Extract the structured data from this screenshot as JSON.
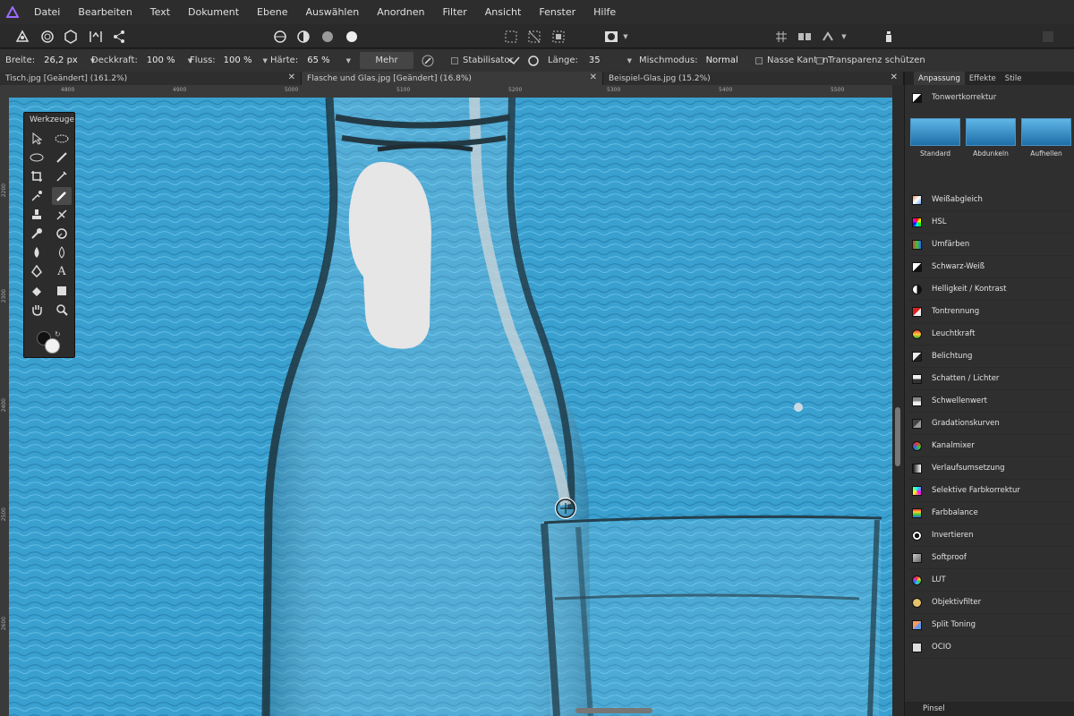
{
  "menu": [
    "Datei",
    "Bearbeiten",
    "Text",
    "Dokument",
    "Ebene",
    "Auswählen",
    "Anordnen",
    "Filter",
    "Ansicht",
    "Fenster",
    "Hilfe"
  ],
  "toolbar": {
    "width_label": "Breite:",
    "width_value": "26,2 px",
    "opacity_label": "Deckkraft:",
    "opacity_value": "100 %",
    "flow_label": "Fluss:",
    "flow_value": "100 %",
    "hardness_label": "Härte:",
    "hardness_value": "65 %",
    "more_label": "Mehr",
    "stabilizer_label": "Stabilisator",
    "length_label": "Länge:",
    "length_value": "35",
    "blendmode_label": "Mischmodus:",
    "blendmode_value": "Normal",
    "wet_edges_label": "Nasse Kanten",
    "protect_alpha_label": "Transparenz schützen"
  },
  "tabs": [
    {
      "label": "Tisch.jpg [Geändert] (161.2%)"
    },
    {
      "label": "Flasche und Glas.jpg [Geändert] (16.8%)"
    },
    {
      "label": "Beispiel-Glas.jpg (15.2%)"
    }
  ],
  "ruler": {
    "h": [
      "4800",
      "4900",
      "5000",
      "5100",
      "5200",
      "5300",
      "5400",
      "5500"
    ],
    "v": [
      "2200",
      "2300",
      "2400",
      "2500",
      "2600"
    ]
  },
  "werkzeuge": {
    "title": "Werkzeuge"
  },
  "panel": {
    "tabs": [
      "Anpassung",
      "Effekte",
      "Stile"
    ],
    "header": "Tonwertkorrektur",
    "presets": [
      "Standard",
      "Abdunkeln",
      "Aufhellen"
    ],
    "items": [
      "Weißabgleich",
      "HSL",
      "Umfärben",
      "Schwarz-Weiß",
      "Helligkeit / Kontrast",
      "Tontrennung",
      "Leuchtkraft",
      "Belichtung",
      "Schatten / Lichter",
      "Schwellenwert",
      "Gradationskurven",
      "Kanalmixer",
      "Verlaufsumsetzung",
      "Selektive Farbkorrektur",
      "Farbbalance",
      "Invertieren",
      "Softproof",
      "LUT",
      "Objektivfilter",
      "Split Toning",
      "OCIO"
    ],
    "footer": "Pinsel"
  },
  "colors": {
    "accent": "#8a5cf5",
    "canvas_bg": "#3aa0cf",
    "panel_bg": "#2f2f2f"
  }
}
